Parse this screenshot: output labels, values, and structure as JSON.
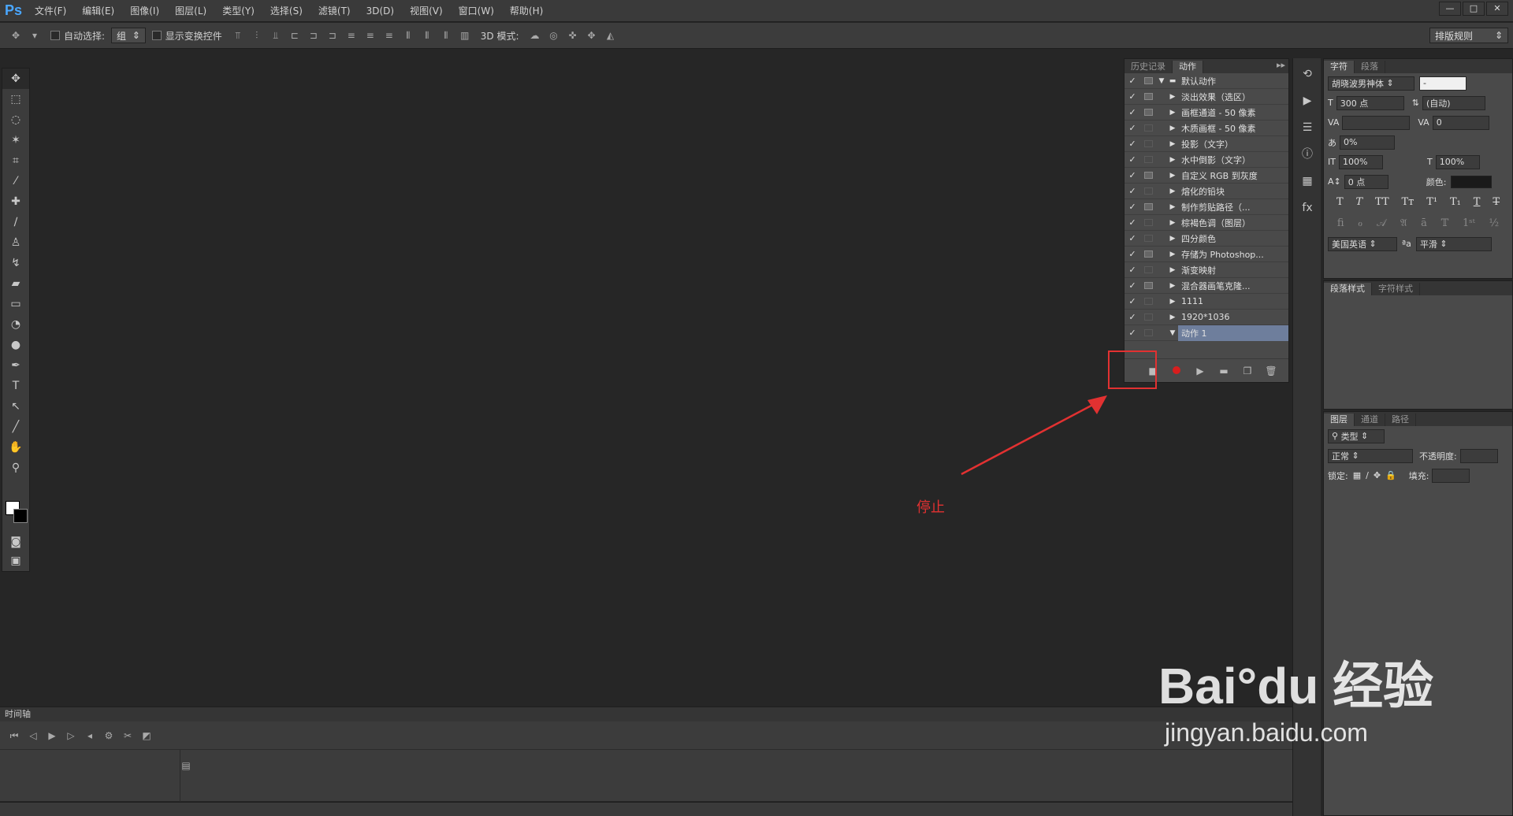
{
  "app": {
    "logo": "Ps"
  },
  "menu": [
    "文件(F)",
    "编辑(E)",
    "图像(I)",
    "图层(L)",
    "类型(Y)",
    "选择(S)",
    "滤镜(T)",
    "3D(D)",
    "视图(V)",
    "窗口(W)",
    "帮助(H)"
  ],
  "window_controls": [
    "—",
    "□",
    "✕"
  ],
  "options": {
    "auto_select_label": "自动选择:",
    "auto_select_value": "组",
    "show_transform_label": "显示变换控件",
    "mode_3d_label": "3D 模式:",
    "workspace": "排版规则"
  },
  "actions_panel": {
    "tabs": [
      "历史记录",
      "动作"
    ],
    "menu_icon": "▸▸",
    "set_name": "默认动作",
    "items": [
      {
        "name": "淡出效果（选区）",
        "dialog": true
      },
      {
        "name": "画框通道 - 50 像素",
        "dialog": true
      },
      {
        "name": "木质画框 - 50 像素",
        "dialog": false
      },
      {
        "name": "投影（文字）",
        "dialog": false
      },
      {
        "name": "水中倒影（文字）",
        "dialog": false
      },
      {
        "name": "自定义 RGB 到灰度",
        "dialog": true
      },
      {
        "name": "熔化的铅块",
        "dialog": false
      },
      {
        "name": "制作剪贴路径（...",
        "dialog": true
      },
      {
        "name": "棕褐色调（图层）",
        "dialog": false
      },
      {
        "name": "四分颜色",
        "dialog": false
      },
      {
        "name": "存储为 Photoshop...",
        "dialog": true
      },
      {
        "name": "渐变映射",
        "dialog": false
      },
      {
        "name": "混合器画笔克隆...",
        "dialog": true
      },
      {
        "name": "1111",
        "dialog": false
      },
      {
        "name": "1920*1036",
        "dialog": false
      },
      {
        "name": "动作 1",
        "dialog": false,
        "selected": true
      }
    ]
  },
  "annotation": {
    "label": "停止",
    "color": "#e23131"
  },
  "char_panel": {
    "tabs": [
      "字符",
      "段落"
    ],
    "font_family": "胡晓波男神体",
    "font_style": "-",
    "size": "300 点",
    "leading": "(自动)",
    "tracking": "0",
    "scale_pct": "0%",
    "vscale": "100%",
    "hscale": "100%",
    "baseline": "0 点",
    "color_label": "颜色:",
    "language": "美国英语",
    "antialias": "平滑"
  },
  "styles_panel": {
    "tabs": [
      "段落样式",
      "字符样式"
    ]
  },
  "layers_panel": {
    "tabs": [
      "图层",
      "通道",
      "路径"
    ],
    "filter": "类型",
    "blend": "正常",
    "opacity_label": "不透明度:",
    "lock_label": "锁定:",
    "fill_label": "填充:"
  },
  "timeline": {
    "title": "时间轴"
  },
  "watermark": {
    "logo": "Bai°du 经验",
    "url": "jingyan.baidu.com"
  }
}
